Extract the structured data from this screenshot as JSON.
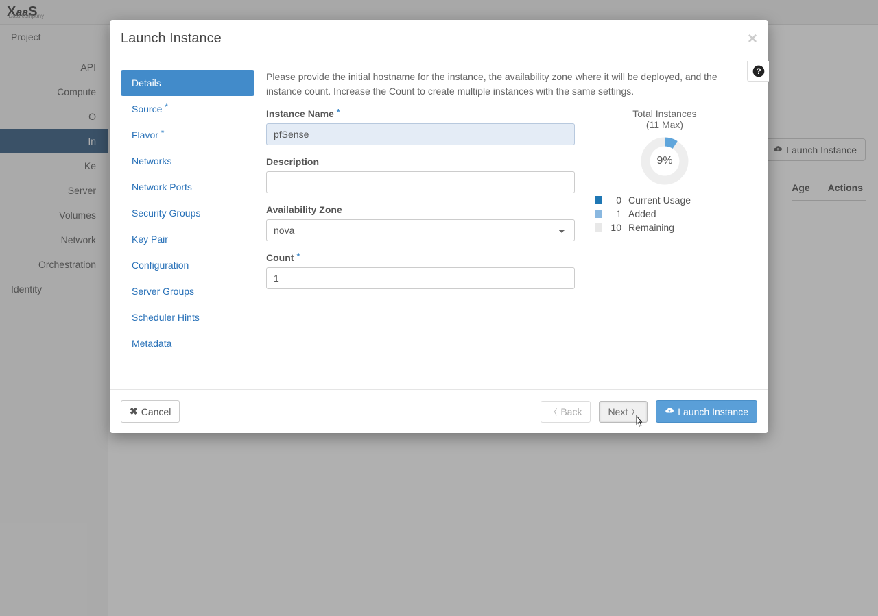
{
  "brand": {
    "name": "XaaS",
    "sub": "Data company"
  },
  "sidebar": {
    "project": "Project",
    "items": [
      "API",
      "Compute",
      "O",
      "In",
      "Ke",
      "Server",
      "Volumes",
      "Network",
      "Orchestration"
    ],
    "identity": "Identity"
  },
  "bg": {
    "launchButton": "Launch Instance",
    "cols": {
      "age": "Age",
      "actions": "Actions"
    }
  },
  "modal": {
    "title": "Launch Instance",
    "nav": [
      {
        "label": "Details",
        "required": false,
        "active": true
      },
      {
        "label": "Source",
        "required": true
      },
      {
        "label": "Flavor",
        "required": true
      },
      {
        "label": "Networks",
        "required": false
      },
      {
        "label": "Network Ports",
        "required": false
      },
      {
        "label": "Security Groups",
        "required": false
      },
      {
        "label": "Key Pair",
        "required": false
      },
      {
        "label": "Configuration",
        "required": false
      },
      {
        "label": "Server Groups",
        "required": false
      },
      {
        "label": "Scheduler Hints",
        "required": false
      },
      {
        "label": "Metadata",
        "required": false
      }
    ],
    "intro": "Please provide the initial hostname for the instance, the availability zone where it will be deployed, and the instance count. Increase the Count to create multiple instances with the same settings.",
    "fields": {
      "instanceName": {
        "label": "Instance Name",
        "value": "pfSense",
        "required": true
      },
      "description": {
        "label": "Description",
        "value": ""
      },
      "availabilityZone": {
        "label": "Availability Zone",
        "value": "nova"
      },
      "count": {
        "label": "Count",
        "value": "1",
        "required": true
      }
    },
    "totals": {
      "title": "Total Instances",
      "max": "(11 Max)",
      "percent": "9%",
      "legend": [
        {
          "n": "0",
          "label": "Current Usage",
          "color": "#1f77b4"
        },
        {
          "n": "1",
          "label": "Added",
          "color": "#8ab8e0"
        },
        {
          "n": "10",
          "label": "Remaining",
          "color": "#e8e8e8"
        }
      ]
    },
    "footer": {
      "cancel": "Cancel",
      "back": "Back",
      "next": "Next",
      "launch": "Launch Instance"
    }
  },
  "chart_data": {
    "type": "pie",
    "title": "Total Instances (11 Max)",
    "series": [
      {
        "name": "Current Usage",
        "value": 0
      },
      {
        "name": "Added",
        "value": 1
      },
      {
        "name": "Remaining",
        "value": 10
      }
    ],
    "percent_label": "9%"
  }
}
